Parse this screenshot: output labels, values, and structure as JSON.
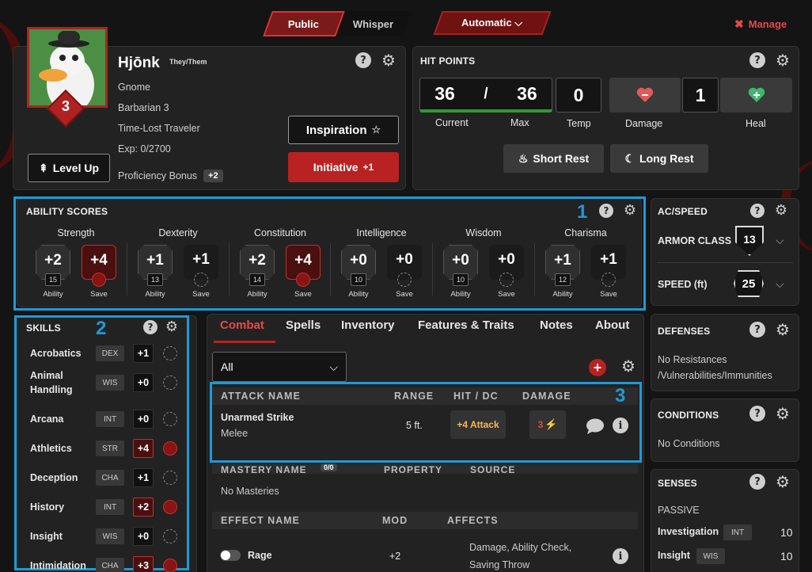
{
  "topbar": {
    "public_label": "Public",
    "whisper_label": "Whisper",
    "automatic_label": "Automatic",
    "manage_label": "Manage"
  },
  "character": {
    "level": "3",
    "name": "Hjōnk",
    "pronouns": "They/Them",
    "race": "Gnome",
    "class": "Barbarian 3",
    "background": "Time-Lost Traveler",
    "exp": "Exp: 0/2700",
    "level_up_label": "Level Up",
    "proficiency_label": "Proficiency Bonus",
    "proficiency_value": "+2",
    "inspiration_label": "Inspiration",
    "initiative_label": "Initiative",
    "initiative_value": "+1"
  },
  "hit_points": {
    "title": "HIT POINTS",
    "current": "36",
    "slash": "/",
    "max": "36",
    "temp": "0",
    "amount": "1",
    "labels": {
      "current": "Current",
      "max": "Max",
      "temp": "Temp",
      "damage": "Damage",
      "heal": "Heal"
    },
    "short_rest_label": "Short Rest",
    "long_rest_label": "Long Rest"
  },
  "ability_scores": {
    "title": "ABILITY SCORES",
    "annotation": "1",
    "ability_sub": "Ability",
    "save_sub": "Save",
    "items": [
      {
        "name": "Strength",
        "mod": "+2",
        "score": "15",
        "save": "+4",
        "save_prof": true
      },
      {
        "name": "Dexterity",
        "mod": "+1",
        "score": "13",
        "save": "+1",
        "save_prof": false
      },
      {
        "name": "Constitution",
        "mod": "+2",
        "score": "14",
        "save": "+4",
        "save_prof": true
      },
      {
        "name": "Intelligence",
        "mod": "+0",
        "score": "10",
        "save": "+0",
        "save_prof": false
      },
      {
        "name": "Wisdom",
        "mod": "+0",
        "score": "10",
        "save": "+0",
        "save_prof": false
      },
      {
        "name": "Charisma",
        "mod": "+1",
        "score": "12",
        "save": "+1",
        "save_prof": false
      }
    ]
  },
  "skills": {
    "title": "SKILLS",
    "annotation": "2",
    "items": [
      {
        "name": "Acrobatics",
        "attr": "DEX",
        "bonus": "+1",
        "prof": false
      },
      {
        "name": "Animal Handling",
        "attr": "WIS",
        "bonus": "+0",
        "prof": false
      },
      {
        "name": "Arcana",
        "attr": "INT",
        "bonus": "+0",
        "prof": false
      },
      {
        "name": "Athletics",
        "attr": "STR",
        "bonus": "+4",
        "prof": true
      },
      {
        "name": "Deception",
        "attr": "CHA",
        "bonus": "+1",
        "prof": false
      },
      {
        "name": "History",
        "attr": "INT",
        "bonus": "+2",
        "prof": true
      },
      {
        "name": "Insight",
        "attr": "WIS",
        "bonus": "+0",
        "prof": false
      },
      {
        "name": "Intimidation",
        "attr": "CHA",
        "bonus": "+3",
        "prof": true
      }
    ]
  },
  "tabs": [
    "Combat",
    "Spells",
    "Inventory",
    "Features & Traits",
    "Notes",
    "About"
  ],
  "combat": {
    "filter_value": "All",
    "annotation": "3",
    "attack_headers": {
      "name": "ATTACK NAME",
      "range": "RANGE",
      "hit": "HIT / DC",
      "damage": "DAMAGE"
    },
    "attack": {
      "name": "Unarmed Strike",
      "type": "Melee",
      "range": "5 ft.",
      "hit": "+4 Attack",
      "damage": "3"
    },
    "mastery_headers": {
      "name": "MASTERY NAME",
      "count": "0/0",
      "property": "PROPERTY",
      "source": "SOURCE"
    },
    "no_masteries": "No Masteries",
    "effect_headers": {
      "name": "EFFECT NAME",
      "mod": "MOD",
      "affects": "AFFECTS"
    },
    "effect": {
      "name": "Rage",
      "mod": "+2",
      "affects_line1": "Damage,  Ability Check,",
      "affects_line2": "Saving Throw"
    }
  },
  "ac_speed": {
    "title": "AC/SPEED",
    "armor_class_label": "ARMOR CLASS",
    "armor_class_value": "13",
    "speed_label": "SPEED (ft)",
    "speed_value": "25"
  },
  "defenses": {
    "title": "DEFENSES",
    "line1": "No Resistances",
    "line2": "/Vulnerabilities/Immunities"
  },
  "conditions": {
    "title": "CONDITIONS",
    "text": "No Conditions"
  },
  "senses": {
    "title": "SENSES",
    "passive_label": "PASSIVE",
    "items": [
      {
        "name": "Investigation",
        "attr": "INT",
        "value": "10"
      },
      {
        "name": "Insight",
        "attr": "WIS",
        "value": "10"
      }
    ]
  },
  "colors": {
    "accent": "#b82222",
    "annotation_blue": "#1e9ad6",
    "panel": "#222222",
    "background": "#141414"
  }
}
